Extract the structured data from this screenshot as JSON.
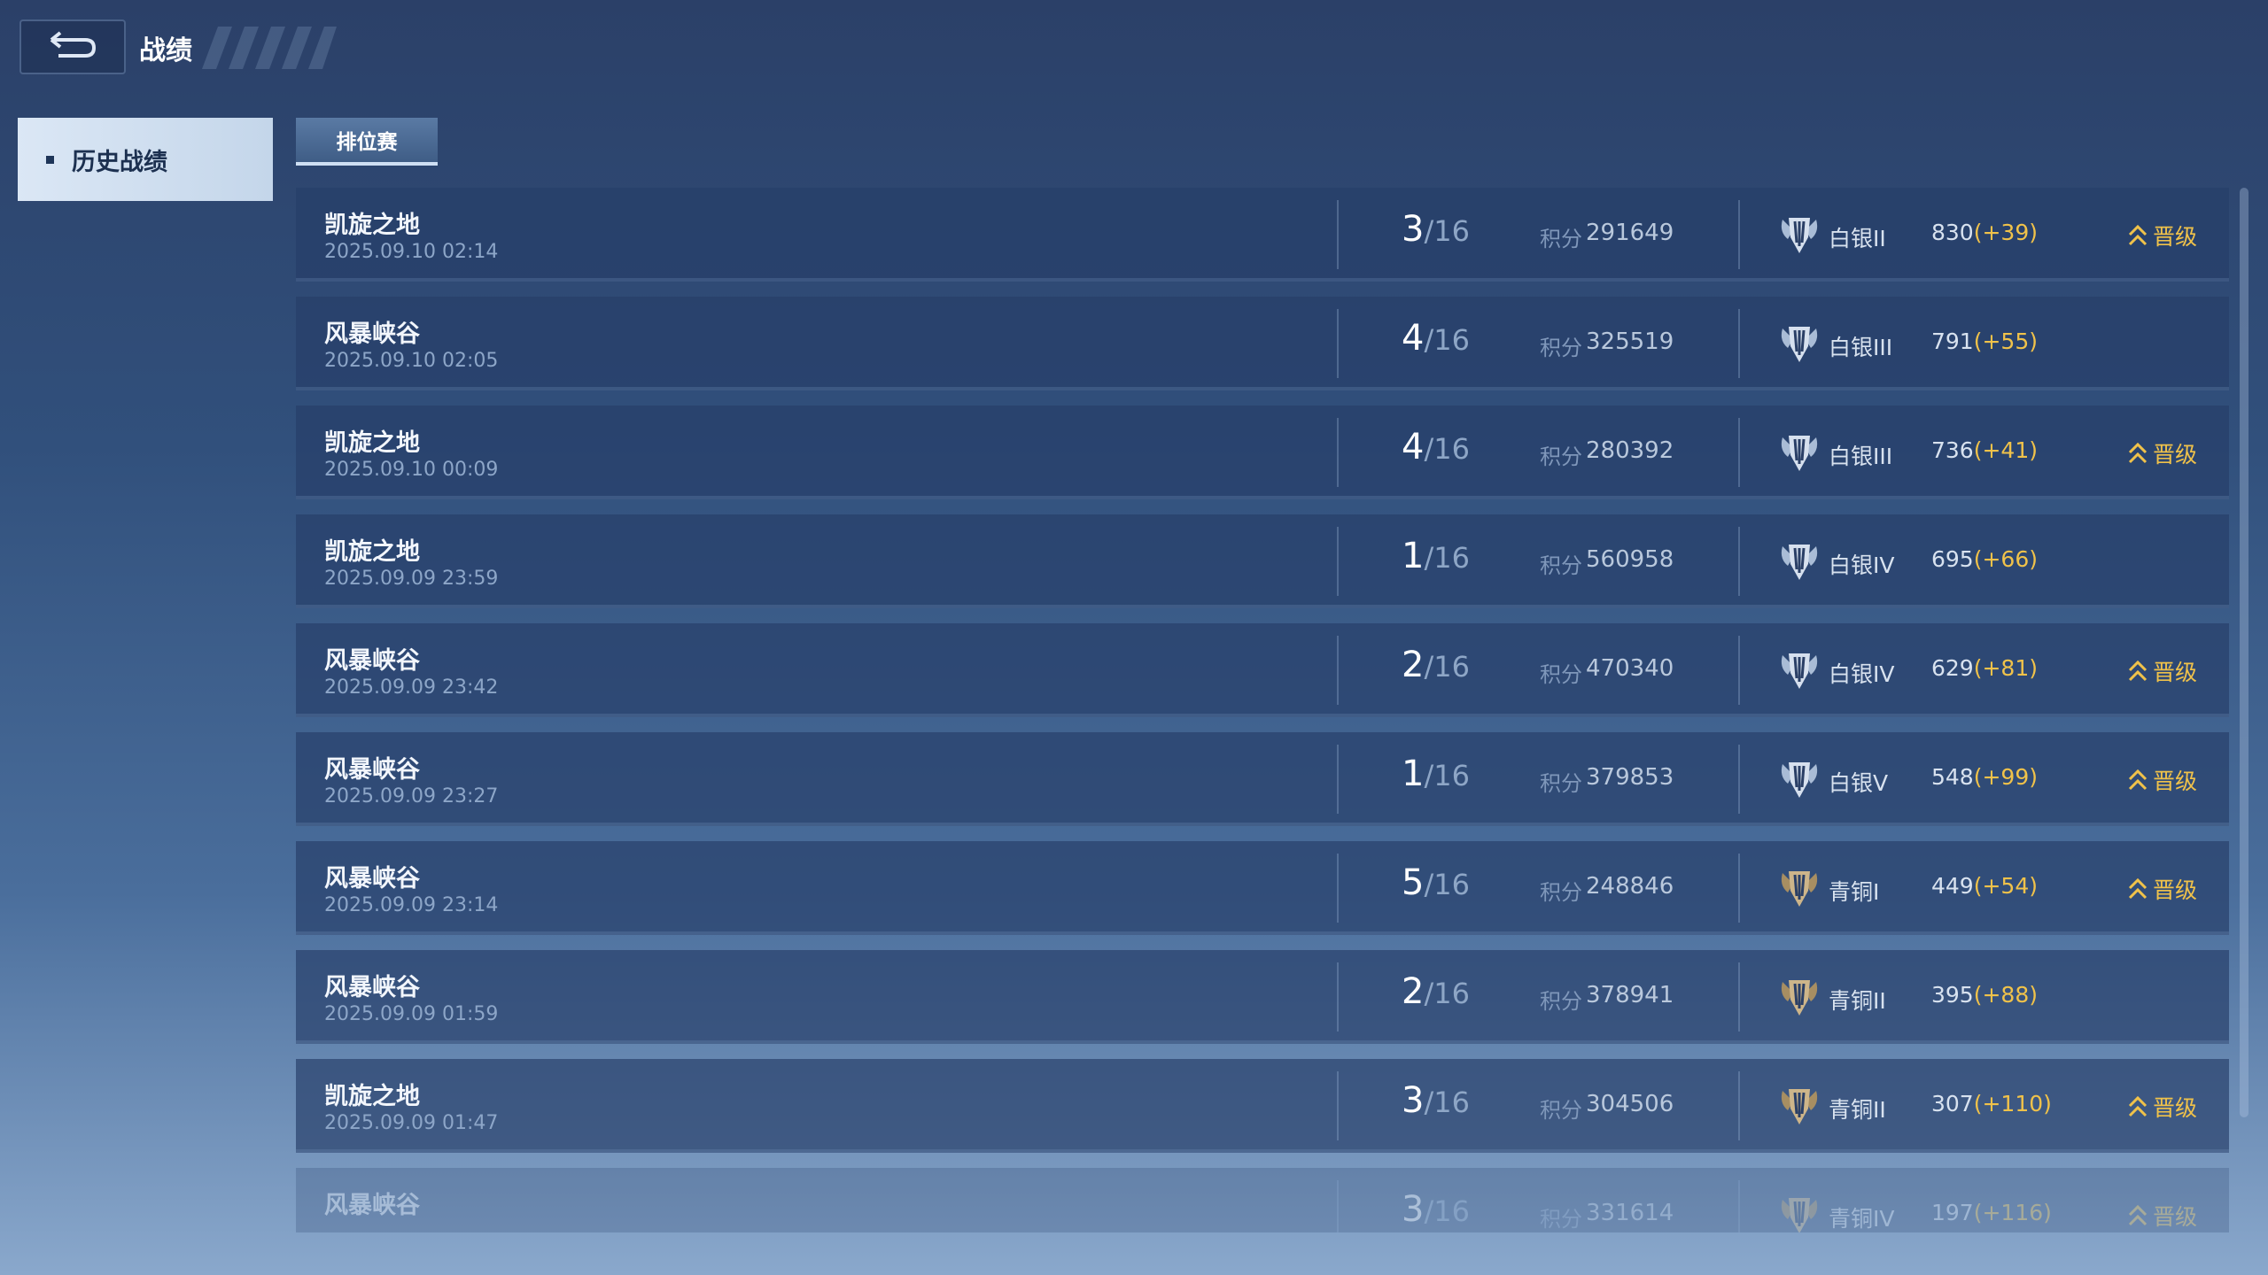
{
  "header": {
    "title": "战绩"
  },
  "sidebar": {
    "items": [
      {
        "label": "历史战绩"
      }
    ]
  },
  "filter": {
    "tab_label": "排位赛"
  },
  "matches": [
    {
      "map": "凯旋之地",
      "time": "2025.09.10 02:14",
      "rank": "3",
      "total": "/16",
      "score_label": "积分",
      "score": "291649",
      "tier": "白银II",
      "tier_icon": "silver-ii",
      "points": "830",
      "delta": "(+39)",
      "promo": "晋级"
    },
    {
      "map": "风暴峡谷",
      "time": "2025.09.10 02:05",
      "rank": "4",
      "total": "/16",
      "score_label": "积分",
      "score": "325519",
      "tier": "白银III",
      "tier_icon": "silver-iii",
      "points": "791",
      "delta": "(+55)",
      "promo": ""
    },
    {
      "map": "凯旋之地",
      "time": "2025.09.10 00:09",
      "rank": "4",
      "total": "/16",
      "score_label": "积分",
      "score": "280392",
      "tier": "白银III",
      "tier_icon": "silver-iii",
      "points": "736",
      "delta": "(+41)",
      "promo": "晋级"
    },
    {
      "map": "凯旋之地",
      "time": "2025.09.09 23:59",
      "rank": "1",
      "total": "/16",
      "score_label": "积分",
      "score": "560958",
      "tier": "白银IV",
      "tier_icon": "silver-iv",
      "points": "695",
      "delta": "(+66)",
      "promo": ""
    },
    {
      "map": "风暴峡谷",
      "time": "2025.09.09 23:42",
      "rank": "2",
      "total": "/16",
      "score_label": "积分",
      "score": "470340",
      "tier": "白银IV",
      "tier_icon": "silver-iv",
      "points": "629",
      "delta": "(+81)",
      "promo": "晋级"
    },
    {
      "map": "风暴峡谷",
      "time": "2025.09.09 23:27",
      "rank": "1",
      "total": "/16",
      "score_label": "积分",
      "score": "379853",
      "tier": "白银V",
      "tier_icon": "silver-v",
      "points": "548",
      "delta": "(+99)",
      "promo": "晋级"
    },
    {
      "map": "风暴峡谷",
      "time": "2025.09.09 23:14",
      "rank": "5",
      "total": "/16",
      "score_label": "积分",
      "score": "248846",
      "tier": "青铜I",
      "tier_icon": "bronze-i",
      "points": "449",
      "delta": "(+54)",
      "promo": "晋级"
    },
    {
      "map": "风暴峡谷",
      "time": "2025.09.09 01:59",
      "rank": "2",
      "total": "/16",
      "score_label": "积分",
      "score": "378941",
      "tier": "青铜II",
      "tier_icon": "bronze-ii",
      "points": "395",
      "delta": "(+88)",
      "promo": ""
    },
    {
      "map": "凯旋之地",
      "time": "2025.09.09 01:47",
      "rank": "3",
      "total": "/16",
      "score_label": "积分",
      "score": "304506",
      "tier": "青铜II",
      "tier_icon": "bronze-ii",
      "points": "307",
      "delta": "(+110)",
      "promo": "晋级"
    },
    {
      "map": "风暴峡谷",
      "time": "",
      "rank": "3",
      "total": "/16",
      "score_label": "积分",
      "score": "331614",
      "tier": "青铜IV",
      "tier_icon": "bronze-iv",
      "points": "197",
      "delta": "(+116)",
      "promo": "晋级"
    }
  ],
  "colors": {
    "accent_gold": "#f0c24a",
    "panel": "#263e68",
    "tab_active": "#dbe7f5"
  },
  "icons": {
    "back": "back-arrow-icon",
    "promo": "double-chevron-up-icon",
    "tier": "tier-shield-icon"
  }
}
